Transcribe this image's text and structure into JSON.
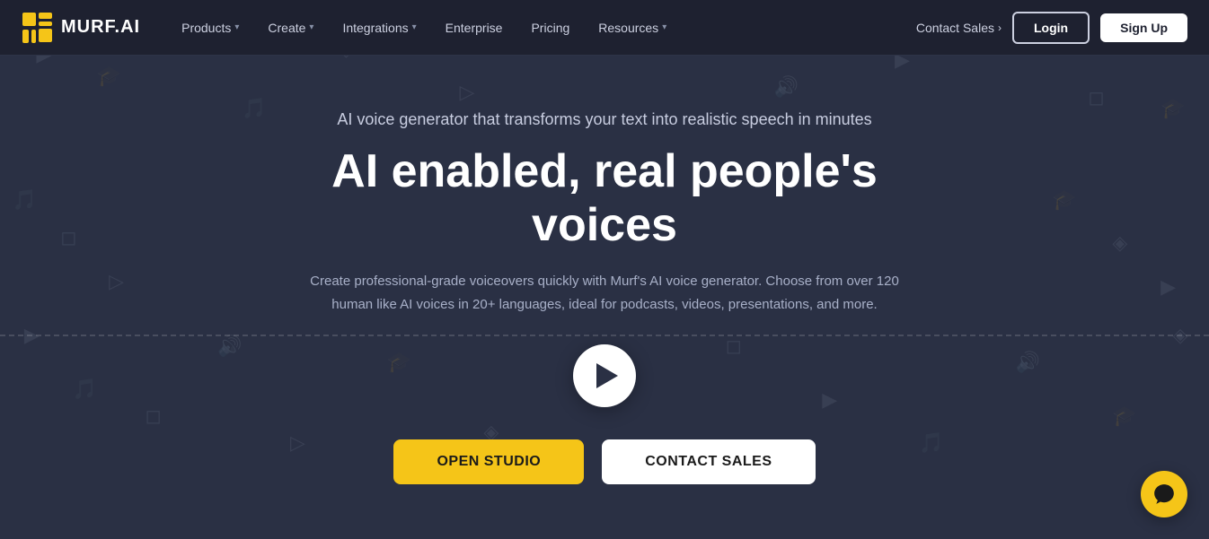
{
  "nav": {
    "logo_text": "MURF.AI",
    "items": [
      {
        "label": "Products",
        "has_dropdown": true
      },
      {
        "label": "Create",
        "has_dropdown": true
      },
      {
        "label": "Integrations",
        "has_dropdown": true
      },
      {
        "label": "Enterprise",
        "has_dropdown": false
      },
      {
        "label": "Pricing",
        "has_dropdown": false
      },
      {
        "label": "Resources",
        "has_dropdown": true
      }
    ],
    "contact_sales": "Contact Sales",
    "login": "Login",
    "signup": "Sign Up"
  },
  "hero": {
    "subtitle": "AI voice generator that transforms your text into realistic speech in minutes",
    "title": "AI enabled, real people's voices",
    "description": "Create professional-grade voiceovers quickly with Murf's AI voice generator. Choose from over 120 human like AI voices in 20+ languages, ideal for podcasts, videos, presentations, and more.",
    "cta_primary": "OPEN STUDIO",
    "cta_secondary": "CONTACT SALES"
  },
  "colors": {
    "accent": "#f5c518",
    "nav_bg": "#1e2130",
    "hero_bg": "#2a3044",
    "text_primary": "#ffffff",
    "text_secondary": "#c8cde0"
  }
}
